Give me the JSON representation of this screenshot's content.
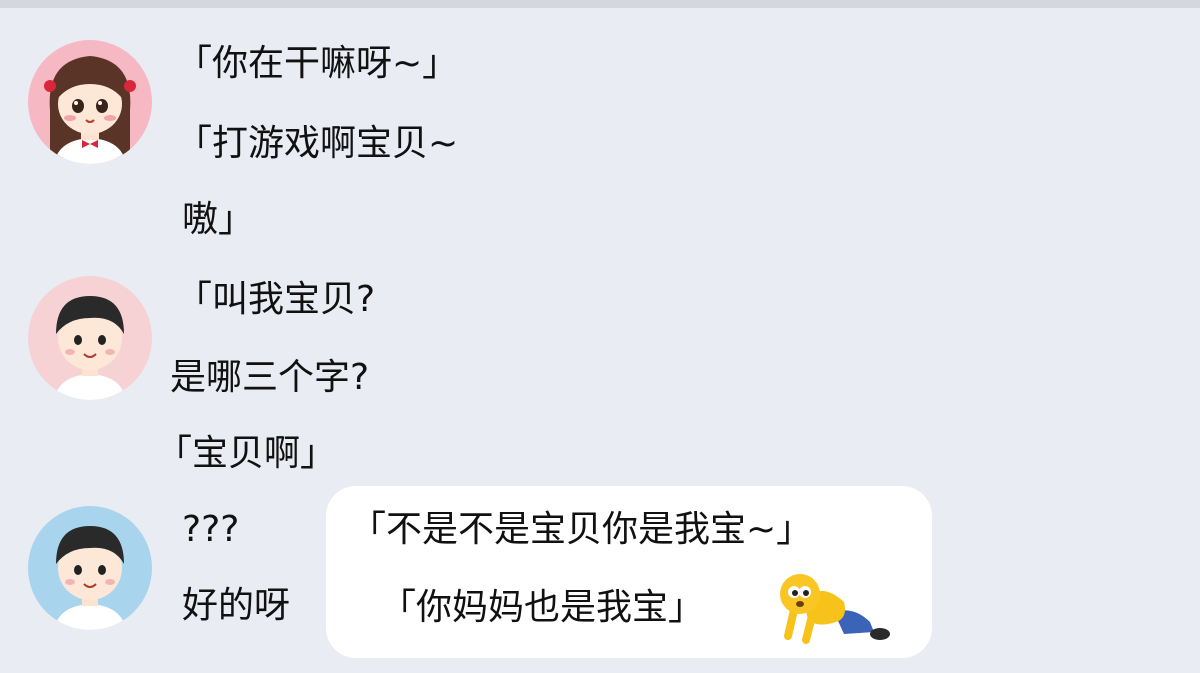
{
  "messages": {
    "m1": "「你在干嘛呀~」",
    "m2": "「打游戏啊宝贝~",
    "m3": "嗷」",
    "m4": "「叫我宝贝?",
    "m5": "是哪三个字?",
    "m6": "「宝贝啊」",
    "m7": "???",
    "m8": "好的呀"
  },
  "bubble": {
    "line1": "「不是不是宝贝你是我宝~」",
    "line2": "「你妈妈也是我宝」"
  },
  "icons": {
    "avatar1": "girl-avatar-icon",
    "avatar2": "boy-avatar-icon",
    "avatar3": "boy-avatar-icon",
    "sticker": "kneeling-emoji-icon"
  },
  "colors": {
    "background": "#e9ecf3",
    "bubble": "#ffffff",
    "avatar1_bg": "#f6b8c2",
    "avatar2_bg": "#f6d2d4",
    "avatar3_bg": "#a9d4ee"
  }
}
